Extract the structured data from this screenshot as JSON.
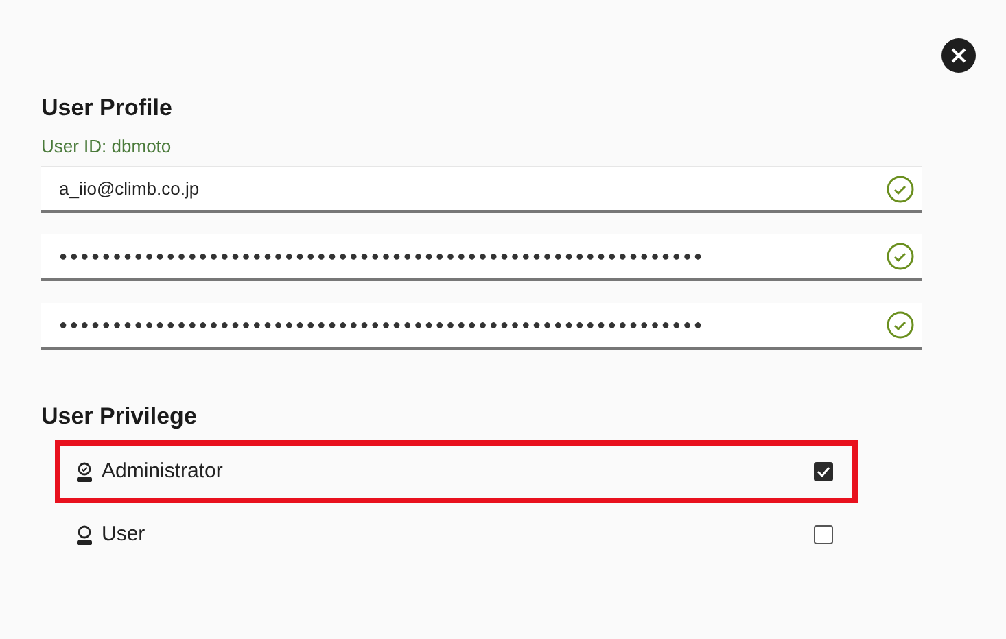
{
  "title": "User Profile",
  "user_id": "User ID: dbmoto",
  "fields": [
    {
      "kind": "email",
      "value": "a_iio@climb.co.jp",
      "valid": true
    },
    {
      "kind": "password",
      "value": "●●●●●●●●●●●●●●●●●●●●●●●●●●●●●●●●●●●●●●●●●●●●●●●●●●●●●●●●●●●●",
      "valid": true
    },
    {
      "kind": "password",
      "value": "●●●●●●●●●●●●●●●●●●●●●●●●●●●●●●●●●●●●●●●●●●●●●●●●●●●●●●●●●●●●",
      "valid": true
    }
  ],
  "privilege_title": "User Privilege",
  "privileges": [
    {
      "kind": "admin",
      "label": "Administrator",
      "checked": true,
      "highlighted": true
    },
    {
      "kind": "user",
      "label": "User",
      "checked": false,
      "highlighted": false
    }
  ]
}
